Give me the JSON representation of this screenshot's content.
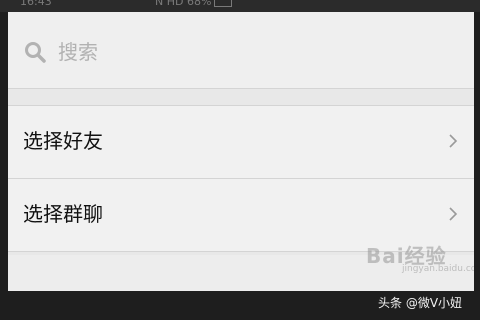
{
  "status_bar": {
    "time": "16:43",
    "indicators": "N HD ",
    "battery": "68%"
  },
  "search": {
    "placeholder": "搜索",
    "icon": "search-icon"
  },
  "menu": {
    "items": [
      {
        "label": "选择好友",
        "icon": "chevron-right-icon"
      },
      {
        "label": "选择群聊",
        "icon": "chevron-right-icon"
      }
    ]
  },
  "watermark": {
    "logo": "Bai经验",
    "subtitle": "jingyan.baidu.com"
  },
  "credit": "头条 @微V小妞",
  "colors": {
    "dialog_bg": "#efefef",
    "divider": "#d4d4d4",
    "placeholder": "#b2b2b2",
    "text": "#111111",
    "backdrop": "#1e1e1e"
  }
}
